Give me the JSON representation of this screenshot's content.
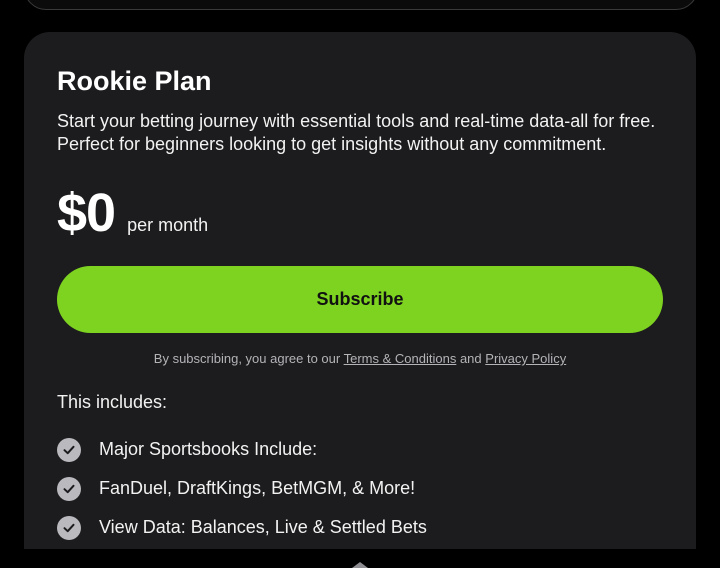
{
  "plan": {
    "title": "Rookie Plan",
    "description_line1": "Start your betting journey with essential tools and real-time data-all for free.",
    "description_line2": "Perfect for beginners looking to get insights without any commitment.",
    "price": "$0",
    "period": "per month",
    "subscribe_label": "Subscribe",
    "legal_prefix": "By subscribing, you agree to our",
    "terms_link": "Terms & Conditions",
    "legal_and": "and",
    "privacy_link": "Privacy Policy",
    "includes_heading": "This includes:",
    "features": [
      {
        "label": "Major Sportsbooks Include:",
        "icon": "check-circle-icon"
      },
      {
        "label": "FanDuel, DraftKings, BetMGM, & More!",
        "icon": "check-circle-icon"
      },
      {
        "label": "View Data: Balances, Live & Settled Bets",
        "icon": "check-circle-icon"
      }
    ]
  },
  "colors": {
    "background": "#000000",
    "card": "#1c1c1e",
    "accent": "#7ed321",
    "check": "#b9b9be"
  }
}
